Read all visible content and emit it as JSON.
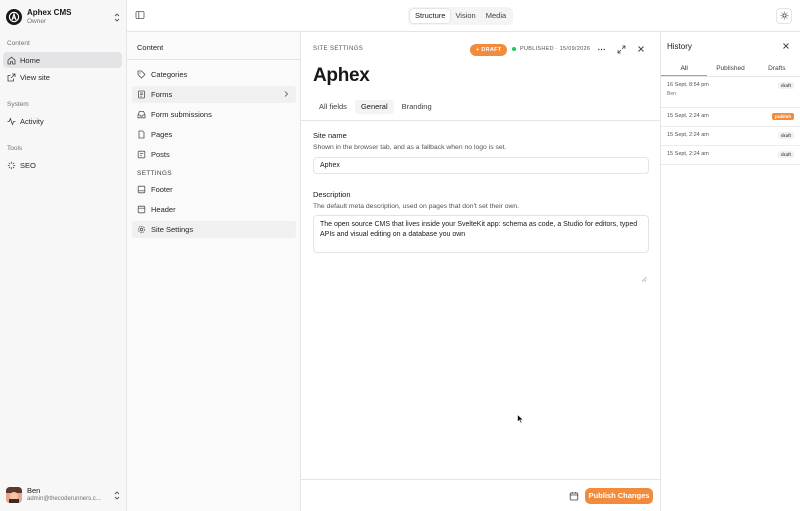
{
  "app": {
    "org_name": "Aphex CMS",
    "org_role": "Owner"
  },
  "sidebar": {
    "groups": [
      {
        "label": "Content",
        "items": [
          {
            "label": "Home",
            "icon": "home-icon",
            "active": true
          },
          {
            "label": "View site",
            "icon": "external-link-icon"
          }
        ]
      },
      {
        "label": "System",
        "items": [
          {
            "label": "Activity",
            "icon": "activity-icon"
          }
        ]
      },
      {
        "label": "Tools",
        "items": [
          {
            "label": "SEO",
            "icon": "seo-icon"
          }
        ]
      }
    ]
  },
  "user": {
    "name": "Ben",
    "email": "admin@thecoderunners.c..."
  },
  "topbar": {
    "views": [
      "Structure",
      "Vision",
      "Media"
    ],
    "active_view": "Structure"
  },
  "structure": {
    "title": "Content",
    "items": [
      {
        "label": "Categories",
        "icon": "tag-icon"
      },
      {
        "label": "Forms",
        "icon": "form-icon",
        "has_children": true
      },
      {
        "label": "Form submissions",
        "icon": "inbox-icon"
      },
      {
        "label": "Pages",
        "icon": "page-icon"
      },
      {
        "label": "Posts",
        "icon": "post-icon"
      }
    ],
    "settings_label": "SETTINGS",
    "settings_items": [
      {
        "label": "Footer",
        "icon": "layout-icon"
      },
      {
        "label": "Header",
        "icon": "layout-icon"
      },
      {
        "label": "Site Settings",
        "icon": "gear-icon",
        "active": true
      }
    ]
  },
  "editor": {
    "doc_type": "SITE SETTINGS",
    "draft_badge": "+ DRAFT",
    "published_status": "PUBLISHED · 15/09/2026",
    "title": "Aphex",
    "tabs": [
      "All fields",
      "General",
      "Branding"
    ],
    "active_tab": "General",
    "fields": {
      "site_name": {
        "label": "Site name",
        "help": "Shown in the browser tab, and as a fallback when no logo is set.",
        "value": "Aphex"
      },
      "description": {
        "label": "Description",
        "help": "The default meta description, used on pages that don't set their own.",
        "value": "The open source CMS that lives inside your SvelteKit app: schema as code, a Studio for editors, typed APIs and visual editing on a database you own"
      }
    },
    "publish_label": "Publish Changes"
  },
  "history": {
    "title": "History",
    "tabs": [
      "All",
      "Published",
      "Drafts"
    ],
    "active_tab": "All",
    "entries": [
      {
        "time": "16 Sept, 8:54 pm",
        "author": "Ben",
        "status": "draft"
      },
      {
        "time": "15 Sept, 2:24 am",
        "author": "",
        "status": "publish"
      },
      {
        "time": "15 Sept, 2:24 am",
        "author": "",
        "status": "draft"
      },
      {
        "time": "15 Sept, 2:24 am",
        "author": "",
        "status": "draft"
      }
    ]
  },
  "colors": {
    "accent": "#f28b3c",
    "published_dot": "#22c55e",
    "sidebar_bg": "#f7f7f8"
  }
}
